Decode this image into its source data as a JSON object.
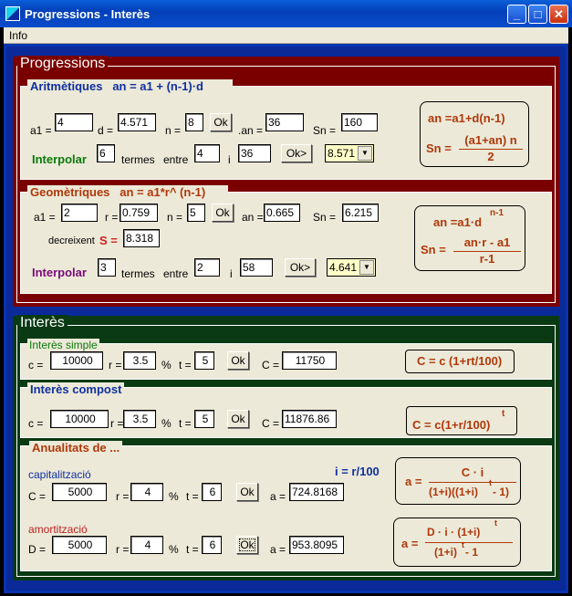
{
  "window": {
    "title": "Progressions - Interès",
    "min": "_",
    "max": "□",
    "close": "✕"
  },
  "menu": {
    "info": "Info"
  },
  "progressions": {
    "title": "Progressions",
    "arit": {
      "title": "Aritmètiques",
      "formula_head": "an = a1 + (n-1)·d",
      "a1_label": "a1 =",
      "a1": "4",
      "d_label": "d =",
      "d": "4.571",
      "n_label": "n =",
      "n": "8",
      "ok": "Ok",
      "an_label": ".an =",
      "an": "36",
      "sn_label": "Sn =",
      "sn": "160",
      "interp_label": "Interpolar",
      "interp": "6",
      "termes": "termes",
      "entre": "entre",
      "e1": "4",
      "i_label": "i",
      "e2": "36",
      "ok2": "Ok>",
      "combo": "8.571",
      "f1": "an =a1+d(n-1)",
      "f2_lhs": "Sn =",
      "f2_num": "(a1+an) n",
      "f2_den": "2"
    },
    "geom": {
      "title": "Geomètriques",
      "formula_head": "an = a1*r^ (n-1)",
      "a1_label": "a1 =",
      "a1": "2",
      "r_label": "r =",
      "r": "0.759",
      "n_label": "n =",
      "n": "5",
      "ok": "Ok",
      "an_label": "an =",
      "an": "0.665",
      "sn_label": "Sn =",
      "sn": "6.215",
      "decr": "decreixent",
      "s_label": "S =",
      "s": "8.318",
      "interp_label": "Interpolar",
      "interp": "3",
      "termes": "termes",
      "entre": "entre",
      "e1": "2",
      "i_label": "i",
      "e2": "58",
      "ok2": "Ok>",
      "combo": "4.641",
      "f1": "an =a1·d",
      "f1_exp": "n-1",
      "f2_lhs": "Sn =",
      "f2_num": "an·r - a1",
      "f2_den": "r-1"
    }
  },
  "interes": {
    "title": "Interès",
    "simple": {
      "title": "Interès simple",
      "c_label": "c =",
      "c": "10000",
      "r_label": "r =",
      "r": "3.5",
      "pct": "%",
      "t_label": "t =",
      "t": "5",
      "ok": "Ok",
      "C_label": "C =",
      "C": "11750",
      "formula": "C = c (1+rt/100)"
    },
    "compost": {
      "title": "Interès compost",
      "c_label": "c =",
      "c": "10000",
      "r_label": "r =",
      "r": "3.5",
      "pct": "%",
      "t_label": "t =",
      "t": "5",
      "ok": "Ok",
      "C_label": "C =",
      "C": "11876.86",
      "formula": "C = c(1+r/100)",
      "formula_exp": "t"
    },
    "anual": {
      "title": "Anualitats de ...",
      "i_formula": "i = r/100",
      "cap": {
        "title": "capitalització",
        "C_label": "C =",
        "C": "5000",
        "r_label": "r =",
        "r": "4",
        "pct": "%",
        "t_label": "t =",
        "t": "6",
        "ok": "Ok",
        "a_label": "a =",
        "a": "724.8168",
        "f_lhs": "a =",
        "f_num": "C · i",
        "f_den": "(1+i)((1+i)",
        "f_den2": " - 1)",
        "f_exp": "t"
      },
      "amo": {
        "title": "amortització",
        "D_label": "D =",
        "D": "5000",
        "r_label": "r =",
        "r": "4",
        "pct": "%",
        "t_label": "t =",
        "t": "6",
        "ok": "Ok",
        "a_label": "a =",
        "a": "953.8095",
        "f_lhs": "a =",
        "f_num": "D · i · (1+i)",
        "f_den": "(1+i)",
        "f_den2": " - 1",
        "f_exp": "t"
      }
    }
  }
}
